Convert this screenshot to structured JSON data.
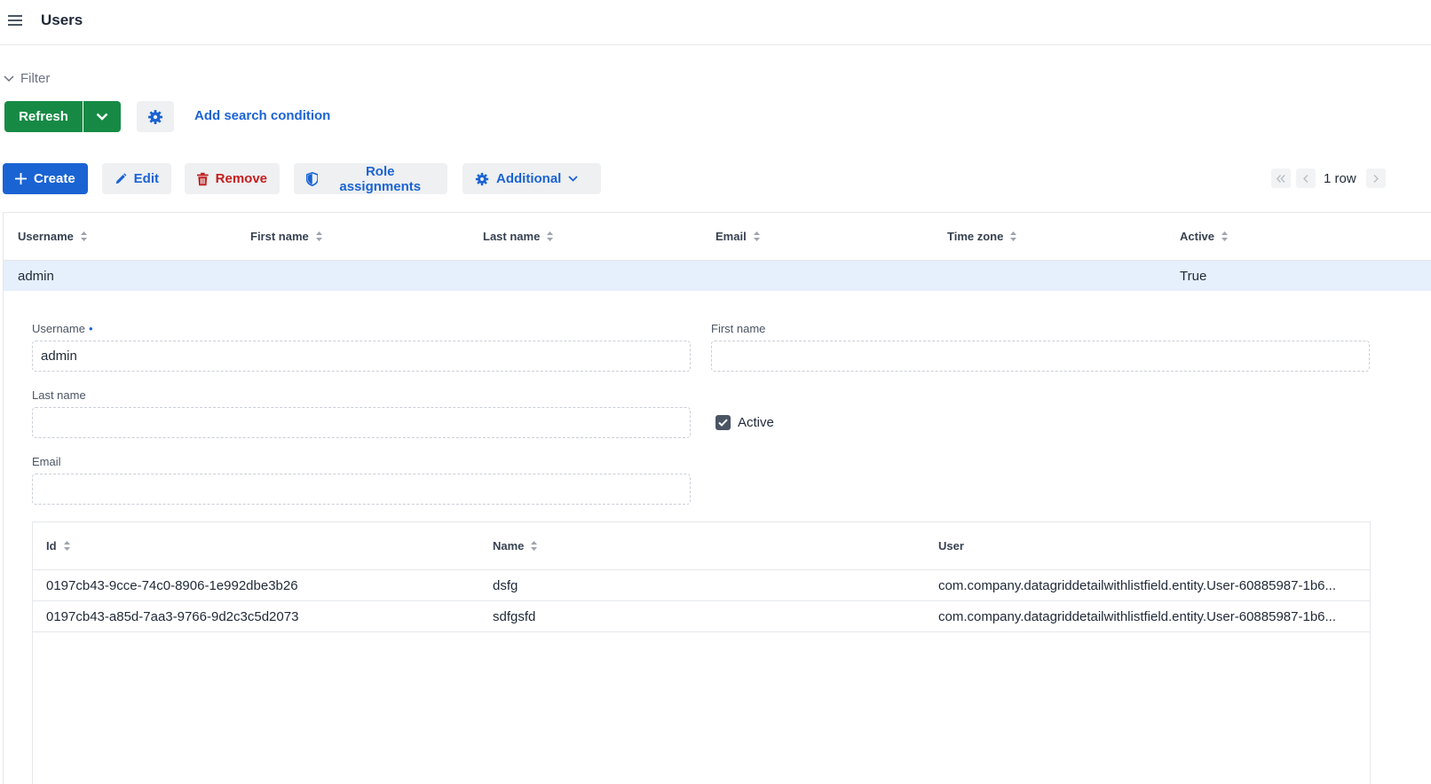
{
  "header": {
    "menu_icon": "hamburger-menu-icon",
    "title": "Users"
  },
  "filter": {
    "label": "Filter",
    "refresh_label": "Refresh",
    "add_condition_label": "Add search condition"
  },
  "toolbar": {
    "create_label": "Create",
    "edit_label": "Edit",
    "remove_label": "Remove",
    "role_assignments_label": "Role assignments",
    "additional_label": "Additional"
  },
  "pagination": {
    "row_count": "1 row"
  },
  "grid": {
    "columns": [
      "Username",
      "First name",
      "Last name",
      "Email",
      "Time zone",
      "Active"
    ],
    "rows": [
      {
        "username": "admin",
        "first_name": "",
        "last_name": "",
        "email": "",
        "time_zone": "",
        "active": "True"
      }
    ]
  },
  "detail": {
    "username_label": "Username",
    "username_required": "•",
    "username_value": "admin",
    "first_name_label": "First name",
    "first_name_value": "",
    "last_name_label": "Last name",
    "last_name_value": "",
    "email_label": "Email",
    "email_value": "",
    "active_label": "Active",
    "active_checked": true
  },
  "subgrid": {
    "columns": [
      "Id",
      "Name",
      "User"
    ],
    "rows": [
      {
        "id": "0197cb43-9cce-74c0-8906-1e992dbe3b26",
        "name": "dsfg",
        "user": "com.company.datagriddetailwithlistfield.entity.User-60885987-1b6..."
      },
      {
        "id": "0197cb43-a85d-7aa3-9766-9d2c3c5d2073",
        "name": "sdfgsfd",
        "user": "com.company.datagriddetailwithlistfield.entity.User-60885987-1b6..."
      }
    ]
  },
  "colors": {
    "primary": "#1a63d3",
    "success": "#168a45",
    "danger": "#c41e1e",
    "selected_row": "#e6effc"
  }
}
